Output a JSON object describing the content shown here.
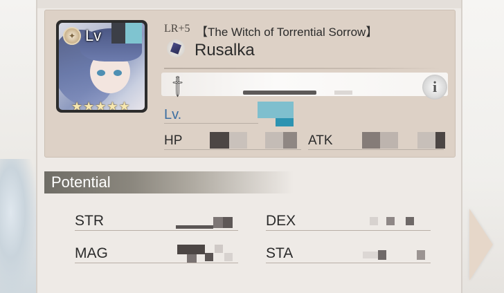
{
  "character": {
    "rarity": "LR+5",
    "epithet": "【The Witch of Torrential Sorrow】",
    "name": "Rusalka",
    "stars": "★★★★★",
    "portrait_lv_label": "Lv"
  },
  "stats": {
    "level_label": "Lv.",
    "hp_label": "HP",
    "atk_label": "ATK"
  },
  "potential": {
    "section_label": "Potential",
    "str_label": "STR",
    "dex_label": "DEX",
    "mag_label": "MAG",
    "sta_label": "STA"
  },
  "icons": {
    "weapon": "sword-icon",
    "info": "info-icon",
    "class": "class-icon",
    "level_badge": "level-badge-icon",
    "next": "next-arrow-icon"
  },
  "colors": {
    "level_text": "#3b6ea1",
    "card_bg": "#ddd1c6",
    "panel_bg": "#eeeae6"
  }
}
